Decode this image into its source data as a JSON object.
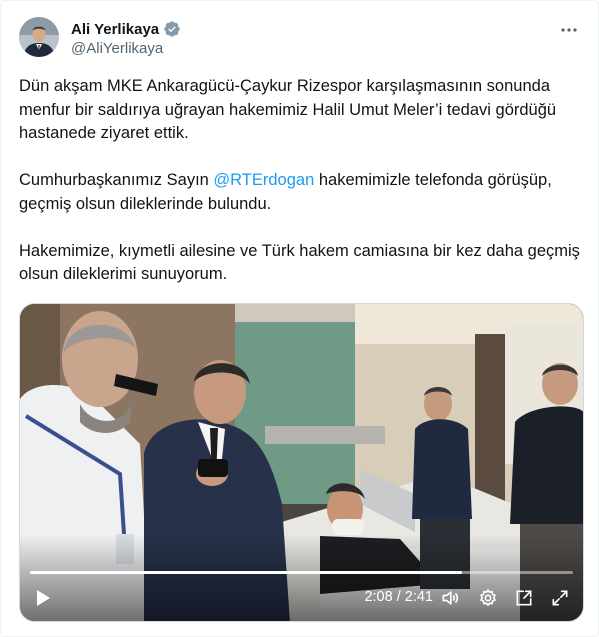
{
  "author": {
    "display_name": "Ali Yerlikaya",
    "handle": "@AliYerlikaya",
    "verified": true,
    "avatar_icon": "profile-photo"
  },
  "tweet": {
    "paragraphs": [
      {
        "text": "Dün akşam MKE Ankaragücü-Çaykur Rizespor karşılaşmasının sonunda menfur bir saldırıya uğrayan hakemimiz Halil Umut Meler’i tedavi gördüğü hastanede ziyaret ettik."
      },
      {
        "before": "Cumhurbaşkanımız Sayın ",
        "mention": "@RTErdogan",
        "after": " hakemimizle telefonda görüşüp, geçmiş olsun dileklerinde bulundu."
      },
      {
        "text": "Hakemimize, kıymetli ailesine ve Türk hakem camiasına bir kez daha geçmiş olsun dileklerimi sunuyorum."
      }
    ]
  },
  "video": {
    "current_time": "2:08",
    "separator": " / ",
    "duration": "2:41",
    "progress": 0.795,
    "icons": [
      "play-icon",
      "volume-icon",
      "settings-icon",
      "popout-icon",
      "fullscreen-icon"
    ]
  },
  "colors": {
    "accent": "#1d9bf0",
    "text": "#0f1419",
    "secondary": "#536471"
  }
}
